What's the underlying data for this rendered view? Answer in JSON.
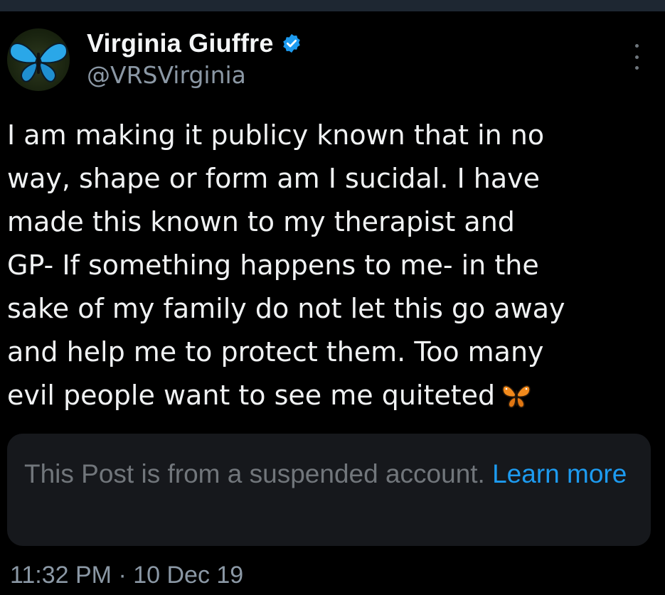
{
  "author": {
    "display_name": "Virginia Giuffre",
    "handle": "@VRSVirginia",
    "verified": true,
    "avatar": "blue-butterfly-avatar"
  },
  "tweet": {
    "lines": [
      "I am making it publicy known that in no",
      "way, shape or form am I sucidal. I have",
      "made this known to my therapist and",
      "GP- If something happens to me- in the",
      "sake of my family do not let this go away",
      "and help me to protect them. Too many",
      "evil people want to see me quiteted"
    ],
    "trailing_emoji": "butterfly-emoji"
  },
  "notice": {
    "text": "This Post is from a suspended account.",
    "link_label": "Learn more"
  },
  "timestamp": "11:32 PM · 10 Dec 19",
  "colors": {
    "background": "#000000",
    "text": "#e7e9ea",
    "secondary": "#8b98a5",
    "link": "#1d9bf0",
    "notice_bg": "#16181c",
    "verified": "#1d9bf0"
  }
}
